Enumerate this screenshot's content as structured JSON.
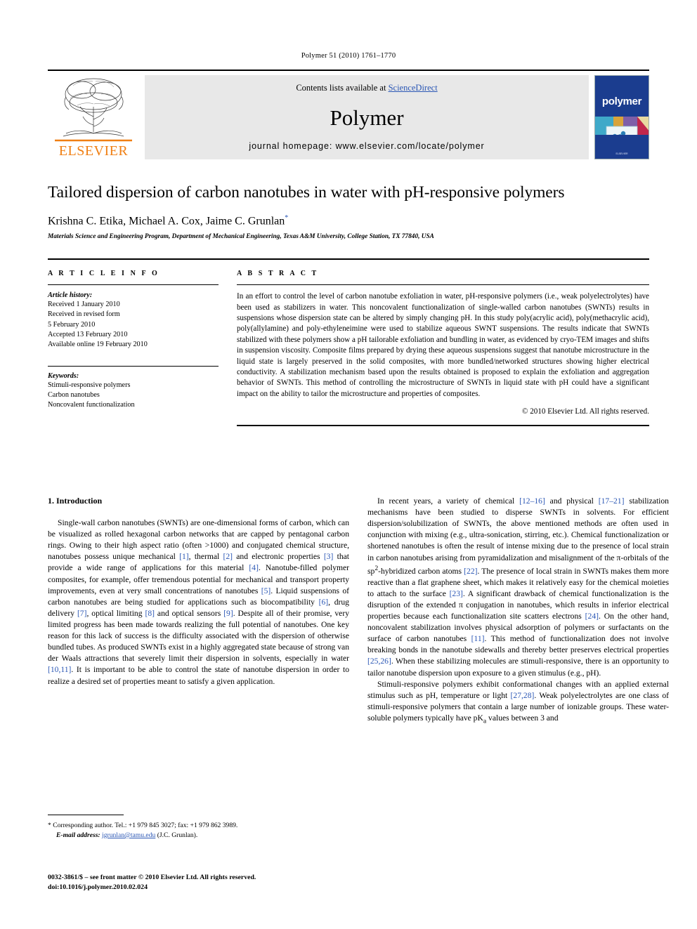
{
  "running_head": "Polymer 51 (2010) 1761–1770",
  "header": {
    "publisher_name": "ELSEVIER",
    "contents_prefix": "Contents lists available at ",
    "contents_link": "ScienceDirect",
    "journal_name": "Polymer",
    "homepage": "journal homepage: www.elsevier.com/locate/polymer",
    "cover_title": "polymer",
    "accent_blue": "#2b57b5",
    "elsevier_orange": "#F07F13",
    "band_gray": "#e8e8e8",
    "cover_blue": "#1b3d8f"
  },
  "article": {
    "title": "Tailored dispersion of carbon nanotubes in water with pH-responsive polymers",
    "authors": "Krishna C. Etika, Michael A. Cox, Jaime C. Grunlan",
    "corresponding_marker": "*",
    "affiliation": "Materials Science and Engineering Program, Department of Mechanical Engineering, Texas A&M University, College Station, TX 77840, USA"
  },
  "article_info": {
    "heading": "A R T I C L E  I N F O",
    "history_label": "Article history:",
    "history": [
      "Received 1 January 2010",
      "Received in revised form",
      "5 February 2010",
      "Accepted 13 February 2010",
      "Available online 19 February 2010"
    ],
    "keywords_label": "Keywords:",
    "keywords": [
      "Stimuli-responsive polymers",
      "Carbon nanotubes",
      "Noncovalent functionalization"
    ]
  },
  "abstract": {
    "heading": "A B S T R A C T",
    "text": "In an effort to control the level of carbon nanotube exfoliation in water, pH-responsive polymers (i.e., weak polyelectrolytes) have been used as stabilizers in water. This noncovalent functionalization of single-walled carbon nanotubes (SWNTs) results in suspensions whose dispersion state can be altered by simply changing pH. In this study poly(acrylic acid), poly(methacrylic acid), poly(allylamine) and poly-ethyleneimine were used to stabilize aqueous SWNT suspensions. The results indicate that SWNTs stabilized with these polymers show a pH tailorable exfoliation and bundling in water, as evidenced by cryo-TEM images and shifts in suspension viscosity. Composite films prepared by drying these aqueous suspensions suggest that nanotube microstructure in the liquid state is largely preserved in the solid composites, with more bundled/networked structures showing higher electrical conductivity. A stabilization mechanism based upon the results obtained is proposed to explain the exfoliation and aggregation behavior of SWNTs. This method of controlling the microstructure of SWNTs in liquid state with pH could have a significant impact on the ability to tailor the microstructure and properties of composites.",
    "copyright": "© 2010 Elsevier Ltd. All rights reserved."
  },
  "introduction": {
    "heading": "1. Introduction",
    "left_paragraph_html": "Single-wall carbon nanotubes (SWNTs) are one-dimensional forms of carbon, which can be visualized as rolled hexagonal carbon networks that are capped by pentagonal carbon rings. Owing to their high aspect ratio (often &gt;1000) and conjugated chemical structure, nanotubes possess unique mechanical <span class=\"cit\">[1]</span>, thermal <span class=\"cit\">[2]</span> and electronic properties <span class=\"cit\">[3]</span> that provide a wide range of applications for this material <span class=\"cit\">[4]</span>. Nanotube-filled polymer composites, for example, offer tremendous potential for mechanical and transport property improvements, even at very small concentrations of nanotubes <span class=\"cit\">[5]</span>. Liquid suspensions of carbon nanotubes are being studied for applications such as biocompatibility <span class=\"cit\">[6]</span>, drug delivery <span class=\"cit\">[7]</span>, optical limiting <span class=\"cit\">[8]</span> and optical sensors <span class=\"cit\">[9]</span>. Despite all of their promise, very limited progress has been made towards realizing the full potential of nanotubes. One key reason for this lack of success is the difficulty associated with the dispersion of otherwise bundled tubes. As produced SWNTs exist in a highly aggregated state because of strong van der Waals attractions that severely limit their dispersion in solvents, especially in water <span class=\"cit\">[10,11]</span>. It is important to be able to control the state of nanotube dispersion in order to realize a desired set of properties meant to satisfy a given application.",
    "right_paragraph_1_html": "In recent years, a variety of chemical <span class=\"cit\">[12–16]</span> and physical <span class=\"cit\">[17–21]</span> stabilization mechanisms have been studied to disperse SWNTs in solvents. For efficient dispersion/solubilization of SWNTs, the above mentioned methods are often used in conjunction with mixing (e.g., ultra-sonication, stirring, etc.). Chemical functionalization or shortened nanotubes is often the result of intense mixing due to the presence of local strain in carbon nanotubes arising from pyramidalization and misalignment of the π-orbitals of the sp<sup>2</sup>-hybridized carbon atoms <span class=\"cit\">[22]</span>. The presence of local strain in SWNTs makes them more reactive than a flat graphene sheet, which makes it relatively easy for the chemical moieties to attach to the surface <span class=\"cit\">[23]</span>. A significant drawback of chemical functionalization is the disruption of the extended π conjugation in nanotubes, which results in inferior electrical properties because each functionalization site scatters electrons <span class=\"cit\">[24]</span>. On the other hand, noncovalent stabilization involves physical adsorption of polymers or surfactants on the surface of carbon nanotubes <span class=\"cit\">[11]</span>. This method of functionalization does not involve breaking bonds in the nanotube sidewalls and thereby better preserves electrical properties <span class=\"cit\">[25,26]</span>. When these stabilizing molecules are stimuli-responsive, there is an opportunity to tailor nanotube dispersion upon exposure to a given stimulus (e.g., pH).",
    "right_paragraph_2_html": "Stimuli-responsive polymers exhibit conformational changes with an applied external stimulus such as pH, temperature or light <span class=\"cit\">[27,28]</span>. Weak polyelectrolytes are one class of stimuli-responsive polymers that contain a large number of ionizable groups. These water-soluble polymers typically have pK<sub>a</sub> values between 3 and"
  },
  "footnote": {
    "marker": "*",
    "corresponding": "Corresponding author. Tel.: +1 979 845 3027; fax: +1 979 862 3989.",
    "email_label": "E-mail address:",
    "email": "jgrunlan@tamu.edu",
    "email_owner": "(J.C. Grunlan)."
  },
  "footer": {
    "issn_line": "0032-3861/$ – see front matter © 2010 Elsevier Ltd. All rights reserved.",
    "doi_line": "doi:10.1016/j.polymer.2010.02.024"
  }
}
